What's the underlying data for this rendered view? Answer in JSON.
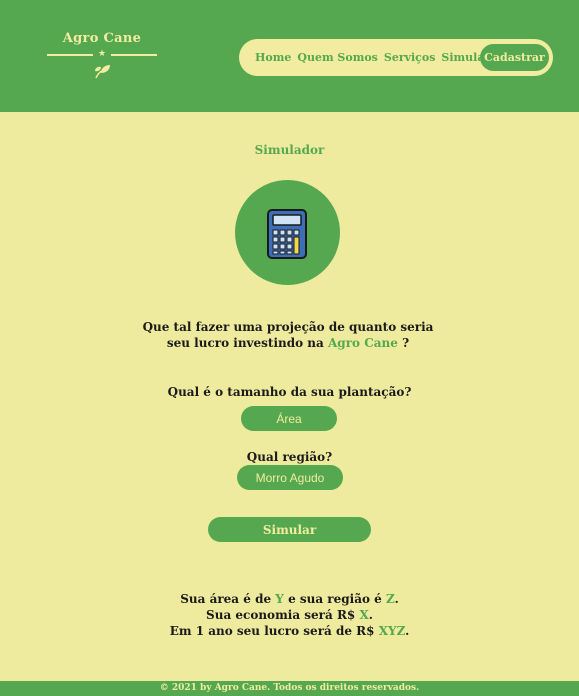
{
  "brand": {
    "name": "Agro Cane",
    "star": "★"
  },
  "nav": {
    "items": [
      "Home",
      "Quem Somos",
      "Serviços",
      "Simulador"
    ],
    "cta": "Cadastrar"
  },
  "section": {
    "title": "Simulador",
    "icon": "calculator-icon"
  },
  "question": {
    "text_before": "Que tal fazer uma projeção de quanto seria seu lucro investindo na",
    "brand": "Agro Cane",
    "text_after": "?"
  },
  "form": {
    "area_label": "Qual é o tamanho da sua plantação?",
    "area_placeholder": "Área",
    "region_label": "Qual região?",
    "region_value": "Morro Agudo",
    "submit_label": "Simular"
  },
  "results": {
    "line1_a": "Sua área é de",
    "line1_y": "Y",
    "line1_b": "e sua região é",
    "line1_z": "Z",
    "line1_end": ".",
    "line2_a": "Sua economia será R$",
    "line2_x": "X",
    "line2_end": ".",
    "line3_a": "Em 1 ano seu lucro será de R$",
    "line3_xyz": "XYZ",
    "line3_end": "."
  },
  "footer": {
    "text": "© 2021 by Agro Cane. Todos os direitos reservados."
  },
  "colors": {
    "green": "#55a84f",
    "cream": "#eeeb9e",
    "text": "#1a1a1a"
  }
}
